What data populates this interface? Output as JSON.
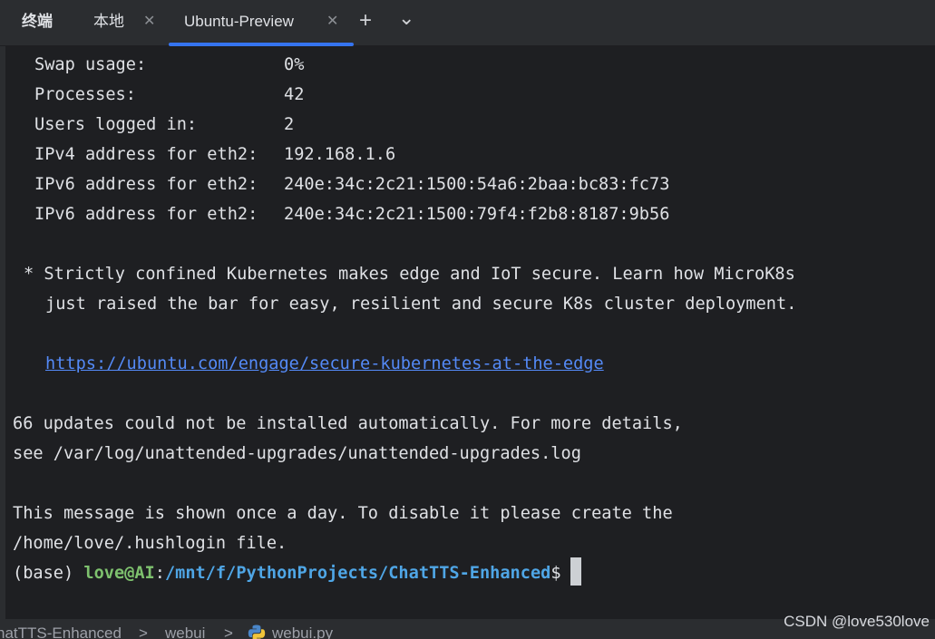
{
  "tabbar": {
    "title": "终端",
    "tabs": [
      {
        "label": "本地",
        "close": "✕"
      },
      {
        "label": "Ubuntu-Preview",
        "close": "✕",
        "active": true
      }
    ],
    "new_tab_glyph": "+",
    "dropdown_glyph": "⌄"
  },
  "terminal": {
    "info": [
      {
        "key": "Swap usage:",
        "value": "0%"
      },
      {
        "key": "Processes:",
        "value": "42"
      },
      {
        "key": "Users logged in:",
        "value": "2"
      },
      {
        "key": "IPv4 address for eth2:",
        "value": "192.168.1.6"
      },
      {
        "key": "IPv6 address for eth2:",
        "value": "240e:34c:2c21:1500:54a6:2baa:bc83:fc73"
      },
      {
        "key": "IPv6 address for eth2:",
        "value": "240e:34c:2c21:1500:79f4:f2b8:8187:9b56"
      }
    ],
    "notice_line1": "* Strictly confined Kubernetes makes edge and IoT secure. Learn how MicroK8s",
    "notice_line2": "just raised the bar for easy, resilient and secure K8s cluster deployment.",
    "link": "https://ubuntu.com/engage/secure-kubernetes-at-the-edge",
    "updates_line1": "66 updates could not be installed automatically. For more details,",
    "updates_line2": "see /var/log/unattended-upgrades/unattended-upgrades.log",
    "message_line1": "This message is shown once a day. To disable it please create the",
    "message_line2": "/home/love/.hushlogin file.",
    "prompt": {
      "env": "(base) ",
      "user": "love@AI",
      "colon": ":",
      "path": "/mnt/f/PythonProjects/ChatTTS-Enhanced",
      "symbol": "$"
    }
  },
  "statusbar": {
    "crumb1": "hatTTS-Enhanced",
    "sep1": ">",
    "crumb2": "webui",
    "sep2": ">",
    "crumb3": "webui.py"
  },
  "watermark": "CSDN @love530love",
  "colors": {
    "accent": "#3574f0",
    "user": "#7ec16e",
    "path": "#4fa6e6",
    "link": "#548af7"
  }
}
